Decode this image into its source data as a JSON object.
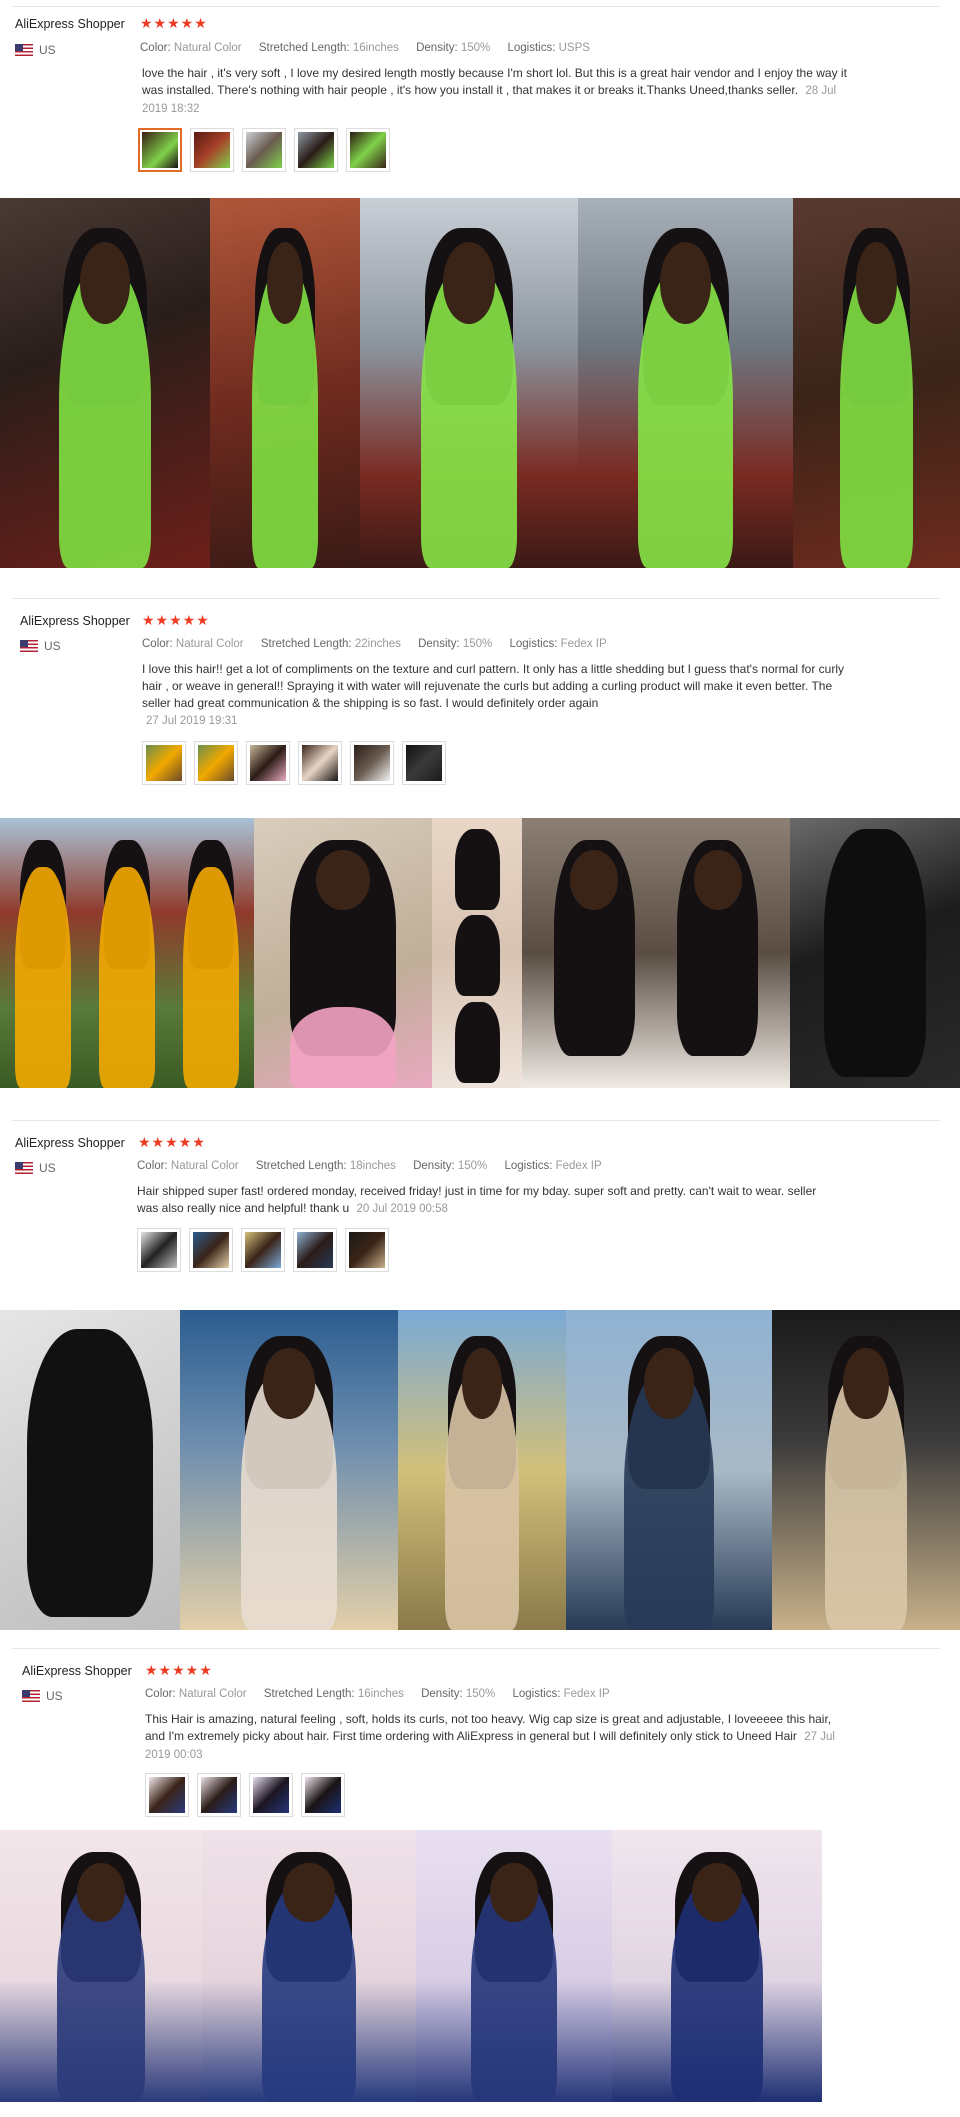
{
  "reviews": [
    {
      "user": "AliExpress Shopper",
      "stars": "★★★★★",
      "country": "US",
      "attrs": [
        {
          "label": "Color:",
          "value": "Natural Color"
        },
        {
          "label": "Stretched Length:",
          "value": "16inches"
        },
        {
          "label": "Density:",
          "value": "150%"
        },
        {
          "label": "Logistics:",
          "value": "USPS"
        }
      ],
      "text": "love the hair , it's very soft , I love my desired length mostly because I'm short lol. But this is a great hair vendor and I enjoy the way it was installed. There's nothing with hair people , it's how you install it , that makes it or breaks it.Thanks Uneed,thanks seller.",
      "date": "28 Jul 2019 18:32"
    },
    {
      "user": "AliExpress Shopper",
      "stars": "★★★★★",
      "country": "US",
      "attrs": [
        {
          "label": "Color:",
          "value": "Natural Color"
        },
        {
          "label": "Stretched Length:",
          "value": "22inches"
        },
        {
          "label": "Density:",
          "value": "150%"
        },
        {
          "label": "Logistics:",
          "value": "Fedex IP"
        }
      ],
      "text": "I love this hair!! get a lot of compliments on the texture and curl pattern. It only has a little shedding but I guess that's normal for curly hair , or weave in general!! Spraying it with water will rejuvenate the curls but adding a curling product will make it even better. The seller had great communication & the shipping is so fast. I would definitely order again",
      "date": "27 Jul 2019 19:31"
    },
    {
      "user": "AliExpress Shopper",
      "stars": "★★★★★",
      "country": "US",
      "attrs": [
        {
          "label": "Color:",
          "value": "Natural Color"
        },
        {
          "label": "Stretched Length:",
          "value": "18inches"
        },
        {
          "label": "Density:",
          "value": "150%"
        },
        {
          "label": "Logistics:",
          "value": "Fedex IP"
        }
      ],
      "text": "Hair shipped super fast! ordered monday, received friday! just in time for my bday. super soft and pretty. can't wait to wear. seller was also really nice and helpful! thank u",
      "date": "20 Jul 2019 00:58"
    },
    {
      "user": "AliExpress Shopper",
      "stars": "★★★★★",
      "country": "US",
      "attrs": [
        {
          "label": "Color:",
          "value": "Natural Color"
        },
        {
          "label": "Stretched Length:",
          "value": "16inches"
        },
        {
          "label": "Density:",
          "value": "150%"
        },
        {
          "label": "Logistics:",
          "value": "Fedex IP"
        }
      ],
      "text": "This Hair is amazing, natural feeling , soft, holds its curls, not too heavy. Wig cap size is great and adjustable, I loveeeee this hair, and I'm extremely picky about hair. First time ordering with AliExpress in general but I will definitely only stick to Uneed Hair",
      "date": "27 Jul 2019 00:03"
    }
  ]
}
